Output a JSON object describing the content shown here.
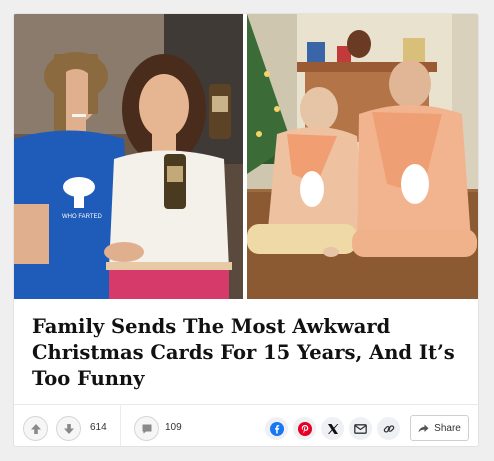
{
  "article": {
    "headline": "Family Sends The Most Awkward Christmas Cards For 15 Years, And It’s Too Funny"
  },
  "photos": [
    {
      "name": "left-photo",
      "shirt_text": "WHO FARTED"
    },
    {
      "name": "right-photo"
    }
  ],
  "actions": {
    "upvote_icon": "arrow-up-icon",
    "downvote_icon": "arrow-down-icon",
    "vote_count": "614",
    "comment_icon": "comment-icon",
    "comment_count": "109",
    "share_label": "Share"
  },
  "colors": {
    "facebook": "#1877f2",
    "pinterest": "#e60023",
    "icon_gray": "#8a8a8a",
    "share_arrow": "#555555"
  }
}
